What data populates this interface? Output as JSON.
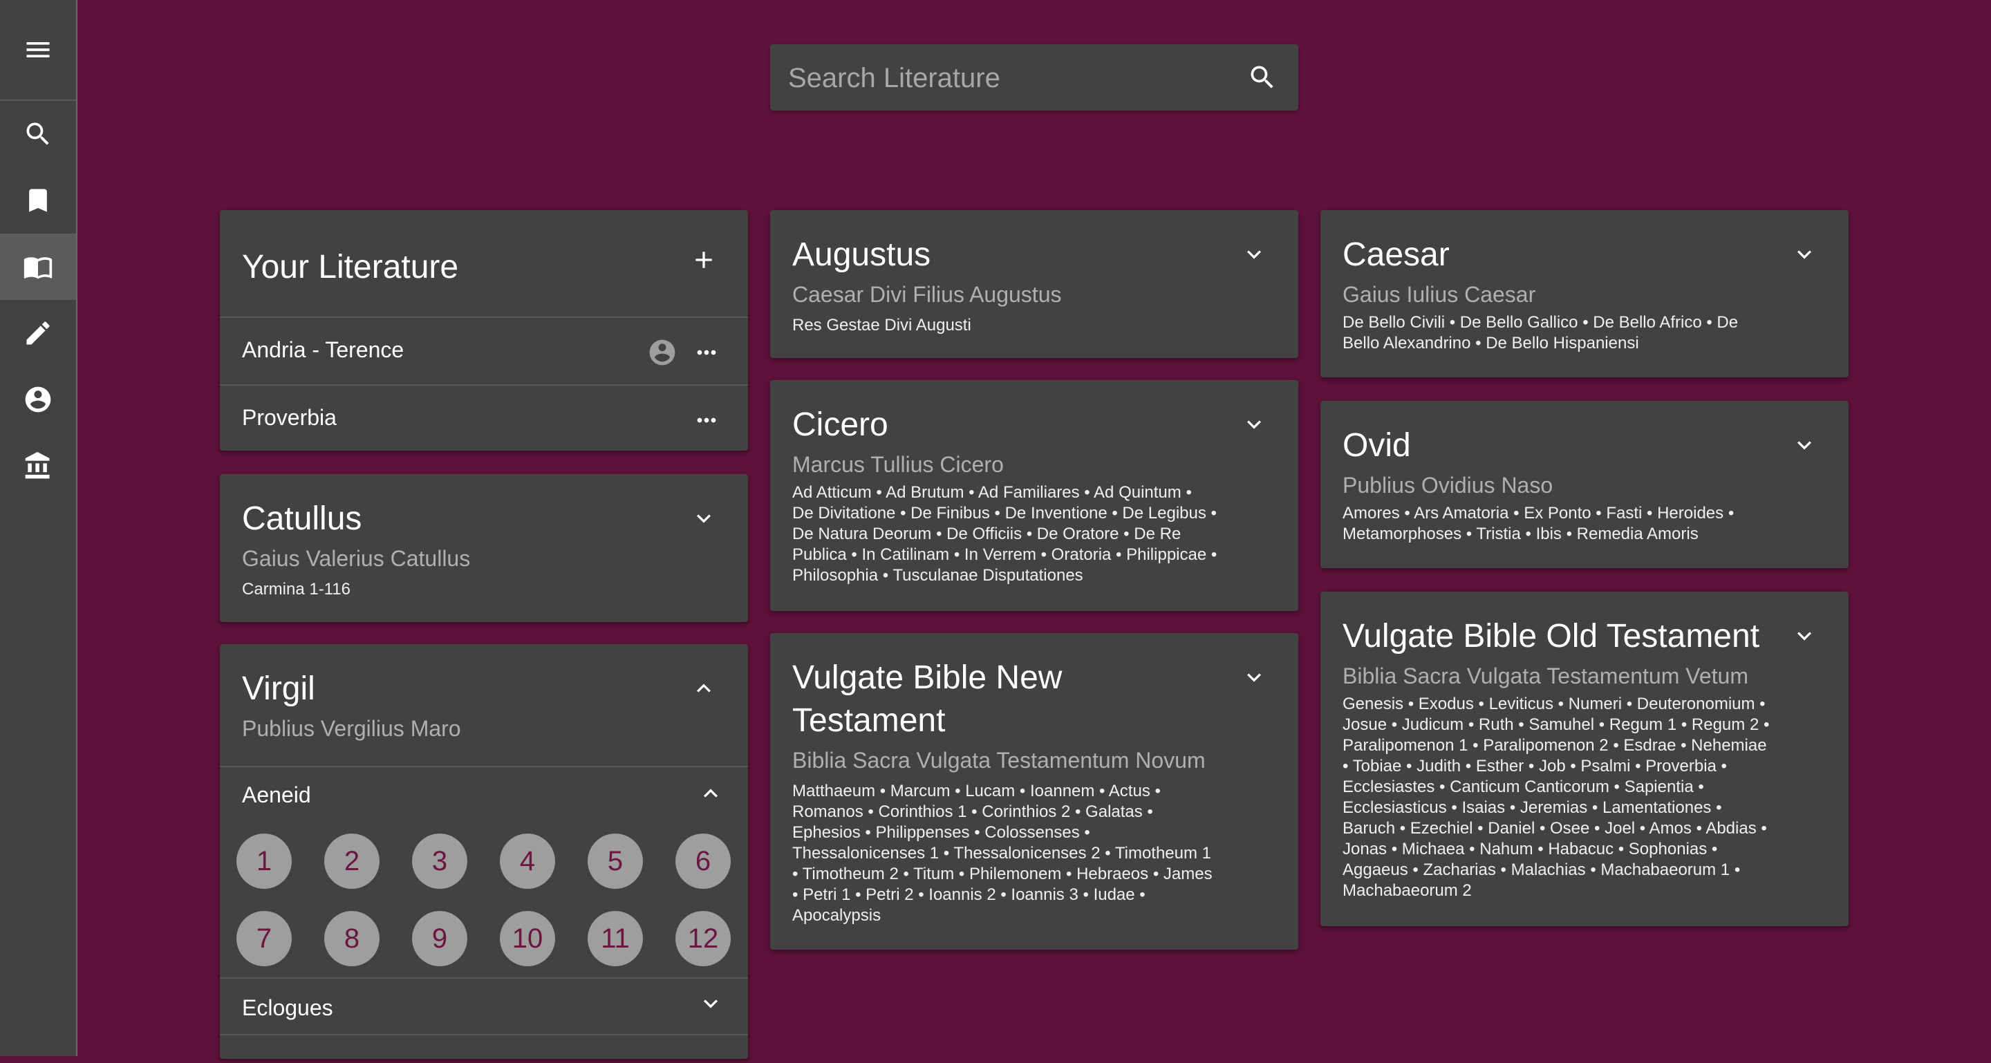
{
  "search": {
    "placeholder": "Search Literature"
  },
  "sidebar": {
    "items": [
      {
        "icon": "menu-icon"
      },
      {
        "icon": "search-icon"
      },
      {
        "icon": "bookmark-icon"
      },
      {
        "icon": "book-open-icon"
      },
      {
        "icon": "pencil-icon"
      },
      {
        "icon": "account-icon"
      },
      {
        "icon": "institution-icon"
      }
    ]
  },
  "your_literature": {
    "title": "Your Literature",
    "items": [
      {
        "name": "Andria - Terence"
      },
      {
        "name": "Proverbia"
      }
    ]
  },
  "authors": {
    "catullus": {
      "name": "Catullus",
      "full_name": "Gaius Valerius Catullus",
      "works": "Carmina 1-116"
    },
    "virgil": {
      "name": "Virgil",
      "full_name": "Publius Vergilius Maro",
      "sections": [
        {
          "name": "Aeneid",
          "books": [
            "1",
            "2",
            "3",
            "4",
            "5",
            "6",
            "7",
            "8",
            "9",
            "10",
            "11",
            "12"
          ]
        },
        {
          "name": "Eclogues"
        }
      ]
    },
    "augustus": {
      "name": "Augustus",
      "full_name": "Caesar Divi Filius Augustus",
      "works": "Res Gestae Divi Augusti"
    },
    "cicero": {
      "name": "Cicero",
      "full_name": "Marcus Tullius Cicero",
      "works_lines": [
        "Ad Atticum • Ad Brutum • Ad Familiares • Ad Quintum •",
        "De Divitatione • De Finibus • De Inventione • De Legibus •",
        "De Natura Deorum • De Officiis • De Oratore • De Re",
        "Publica • In Catilinam • In Verrem • Oratoria • Philippicae •",
        "Philosophia • Tusculanae Disputationes"
      ]
    },
    "vulgate_nt": {
      "name_lines": [
        "Vulgate Bible New",
        "Testament"
      ],
      "full_name": "Biblia Sacra Vulgata Testamentum Novum",
      "works_lines": [
        "Matthaeum • Marcum • Lucam • Ioannem • Actus •",
        "Romanos • Corinthios 1 • Corinthios 2 • Galatas •",
        "Ephesios • Philippenses • Colossenses •",
        "Thessalonicenses 1 • Thessalonicenses 2 • Timotheum 1",
        "• Timotheum 2 • Titum • Philemonem • Hebraeos • James",
        "• Petri 1 • Petri 2 • Ioannis 2 • Ioannis 3 • Iudae •",
        "Apocalypsis"
      ]
    },
    "caesar": {
      "name": "Caesar",
      "full_name": "Gaius Iulius Caesar",
      "works_lines": [
        "De Bello Civili • De Bello Gallico • De Bello Africo • De",
        "Bello Alexandrino • De Bello Hispaniensi"
      ]
    },
    "ovid": {
      "name": "Ovid",
      "full_name": "Publius Ovidius Naso",
      "works_lines": [
        "Amores • Ars Amatoria • Ex Ponto • Fasti • Heroides •",
        "Metamorphoses • Tristia • Ibis • Remedia Amoris"
      ]
    },
    "vulgate_ot": {
      "name": "Vulgate Bible Old Testament",
      "full_name": "Biblia Sacra Vulgata Testamentum Vetum",
      "works_lines": [
        "Genesis • Exodus • Leviticus • Numeri • Deuteronomium •",
        "Josue • Judicum • Ruth • Samuhel • Regum 1 • Regum 2 •",
        "Paralipomenon 1 • Paralipomenon 2 • Esdrae • Nehemiae",
        "• Tobiae • Judith • Esther • Job • Psalmi • Proverbia •",
        "Ecclesiastes • Canticum Canticorum • Sapientia •",
        "Ecclesiasticus • Isaias • Jeremias • Lamentationes •",
        "Baruch • Ezechiel • Daniel • Osee • Joel • Amos • Abdias •",
        "Jonas • Michaea • Nahum • Habacuc • Sophonias •",
        "Aggaeus • Zacharias • Malachias • Machabaeorum 1 •",
        "Machabaeorum 2"
      ]
    }
  }
}
